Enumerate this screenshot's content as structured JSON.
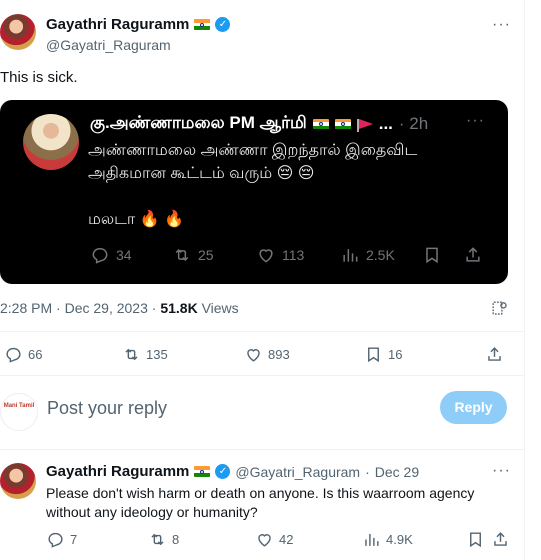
{
  "tweet": {
    "author_name": "Gayathri Raguramm",
    "author_handle": "@Gayatri_Raguram",
    "text": "This is sick.",
    "more_label": "···",
    "timestamp": "2:28 PM · Dec 29, 2023",
    "dot": "·",
    "views_count": "51.8K",
    "views_label": "Views",
    "stats": {
      "replies": "66",
      "reposts": "135",
      "likes": "893",
      "bookmarks": "16"
    }
  },
  "quoted": {
    "author_name": "கு.அண்ணாமலை PM ஆர்மி",
    "trail": "...",
    "time": "· 2h",
    "more_label": "···",
    "line1": "அண்ணாமலை அண்ணா இறந்தால் இதைவிட",
    "line2": "அதிகமான கூட்டம் வரும் 😔 😔",
    "line3": "மலடா 🔥 🔥",
    "stats": {
      "replies": "34",
      "reposts": "25",
      "likes": "113",
      "views": "2.5K"
    }
  },
  "composer": {
    "avatar_text": "Mani Tamil",
    "placeholder": "Post your reply",
    "reply_button": "Reply"
  },
  "reply": {
    "author_name": "Gayathri Raguramm",
    "author_handle": "@Gayatri_Raguram",
    "dot": "·",
    "time": "Dec 29",
    "more_label": "···",
    "text": "Please don't wish harm or death on anyone. Is this waarroom agency without any ideology or humanity?",
    "stats": {
      "replies": "7",
      "reposts": "8",
      "likes": "42",
      "views": "4.9K"
    }
  },
  "colors": {
    "accent": "#1d9bf0",
    "reply_button_disabled": "#8ecdf8",
    "secondary_text": "#536471",
    "card_bg": "#000000"
  },
  "icons": [
    "verified-badge-icon",
    "india-flag-icon",
    "red-flag-icon",
    "reply-icon",
    "repost-icon",
    "like-icon",
    "views-icon",
    "bookmark-icon",
    "share-icon",
    "more-icon",
    "grok-icon"
  ]
}
